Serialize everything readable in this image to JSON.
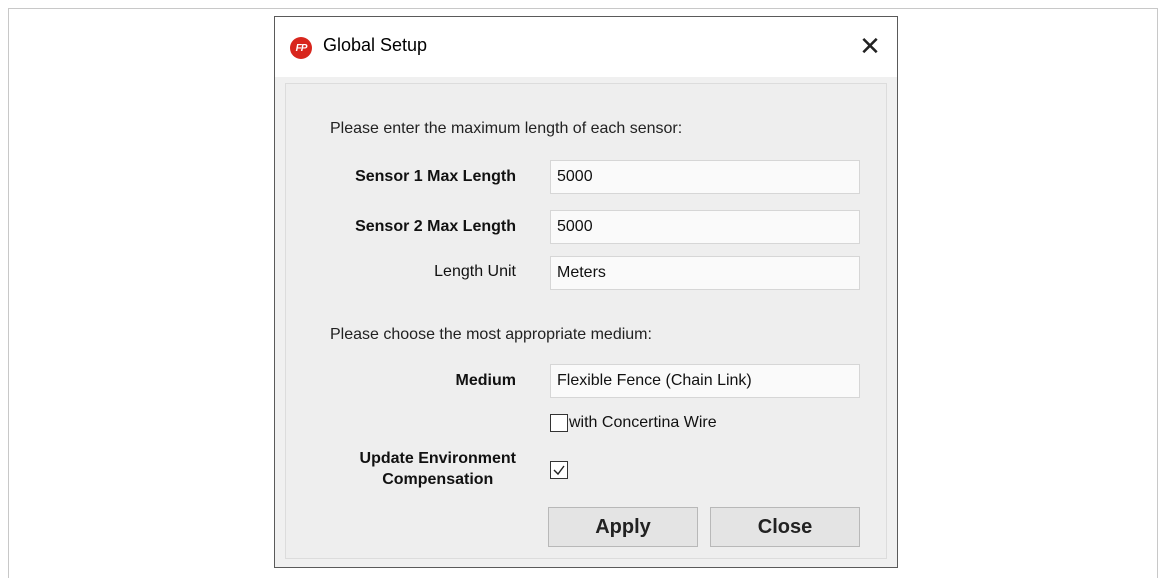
{
  "dialog": {
    "title": "Global Setup",
    "app_icon_text": "FP",
    "close_glyph": "✕"
  },
  "form": {
    "intro_text": "Please enter the maximum length of each sensor:",
    "sensor1": {
      "label": "Sensor 1 Max Length",
      "value": "5000"
    },
    "sensor2": {
      "label": "Sensor 2 Max Length",
      "value": "5000"
    },
    "unit": {
      "label": "Length Unit",
      "value": "Meters"
    },
    "medium_intro": "Please choose the most appropriate medium:",
    "medium": {
      "label": "Medium",
      "value": "Flexible Fence (Chain Link)"
    },
    "concertina": {
      "label": "with Concertina Wire",
      "checked": false
    },
    "update_env": {
      "label_line1": "Update Environment",
      "label_line2": "Compensation",
      "checked": true
    }
  },
  "buttons": {
    "apply": "Apply",
    "close": "Close"
  },
  "colors": {
    "app_icon": "#d8261d",
    "dialog_bg": "#f0f0f0",
    "titlebar_bg": "#ffffff"
  }
}
